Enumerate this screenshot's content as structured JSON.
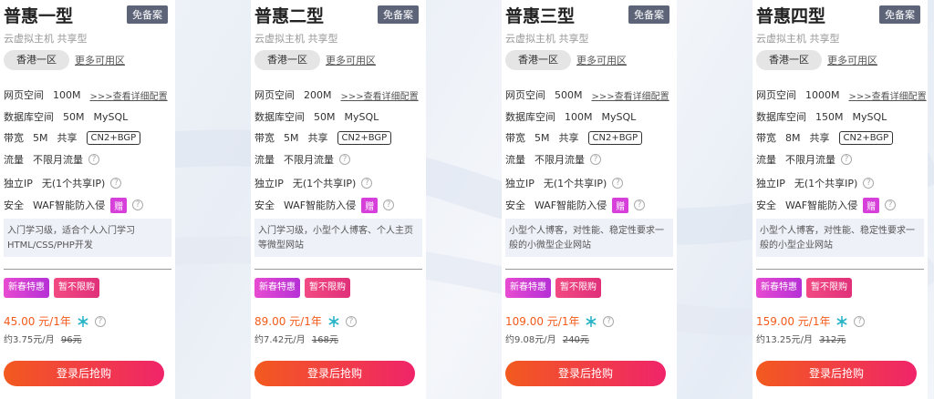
{
  "plans": [
    {
      "title": "普惠一型",
      "badge": "免备案",
      "subtitle": "云虚拟主机 共享型",
      "region": "香港一区",
      "more_regions": "更多可用区",
      "web_space_label": "网页空间",
      "web_space": "100M",
      "details_link": ">>>查看详细配置",
      "db_label": "数据库空间",
      "db_size": "50M",
      "db_type": "MySQL",
      "bw_label": "带宽",
      "bw": "5M",
      "bw_type": "共享",
      "bw_line": "CN2+BGP",
      "traffic_label": "流量",
      "traffic": "不限月流量",
      "ip_label": "独立IP",
      "ip": "无(1个共享IP)",
      "sec_label": "安全",
      "sec": "WAF智能防入侵",
      "gift": "赠",
      "desc": "入门学习级，适合个人入门学习HTML/CSS/PHP开发",
      "promo1": "新春特惠",
      "promo2": "暂不限购",
      "price": "45.00 元/1年",
      "monthly": "约3.75元/月",
      "orig": "96元",
      "buy": "登录后抢购"
    },
    {
      "title": "普惠二型",
      "badge": "免备案",
      "subtitle": "云虚拟主机 共享型",
      "region": "香港一区",
      "more_regions": "更多可用区",
      "web_space_label": "网页空间",
      "web_space": "200M",
      "details_link": ">>>查看详细配置",
      "db_label": "数据库空间",
      "db_size": "50M",
      "db_type": "MySQL",
      "bw_label": "带宽",
      "bw": "5M",
      "bw_type": "共享",
      "bw_line": "CN2+BGP",
      "traffic_label": "流量",
      "traffic": "不限月流量",
      "ip_label": "独立IP",
      "ip": "无(1个共享IP)",
      "sec_label": "安全",
      "sec": "WAF智能防入侵",
      "gift": "赠",
      "desc": "入门学习级，小型个人博客、个人主页等微型网站",
      "promo1": "新春特惠",
      "promo2": "暂不限购",
      "price": "89.00 元/1年",
      "monthly": "约7.42元/月",
      "orig": "168元",
      "buy": "登录后抢购"
    },
    {
      "title": "普惠三型",
      "badge": "免备案",
      "subtitle": "云虚拟主机 共享型",
      "region": "香港一区",
      "more_regions": "更多可用区",
      "web_space_label": "网页空间",
      "web_space": "500M",
      "details_link": ">>>查看详细配置",
      "db_label": "数据库空间",
      "db_size": "100M",
      "db_type": "MySQL",
      "bw_label": "带宽",
      "bw": "5M",
      "bw_type": "共享",
      "bw_line": "CN2+BGP",
      "traffic_label": "流量",
      "traffic": "不限月流量",
      "ip_label": "独立IP",
      "ip": "无(1个共享IP)",
      "sec_label": "安全",
      "sec": "WAF智能防入侵",
      "gift": "赠",
      "desc": "小型个人博客，对性能、稳定性要求一般的小微型企业网站",
      "promo1": "新春特惠",
      "promo2": "暂不限购",
      "price": "109.00 元/1年",
      "monthly": "约9.08元/月",
      "orig": "240元",
      "buy": "登录后抢购"
    },
    {
      "title": "普惠四型",
      "badge": "免备案",
      "subtitle": "云虚拟主机 共享型",
      "region": "香港一区",
      "more_regions": "更多可用区",
      "web_space_label": "网页空间",
      "web_space": "1000M",
      "details_link": ">>>查看详细配置",
      "db_label": "数据库空间",
      "db_size": "150M",
      "db_type": "MySQL",
      "bw_label": "带宽",
      "bw": "8M",
      "bw_type": "共享",
      "bw_line": "CN2+BGP",
      "traffic_label": "流量",
      "traffic": "不限月流量",
      "ip_label": "独立IP",
      "ip": "无(1个共享IP)",
      "sec_label": "安全",
      "sec": "WAF智能防入侵",
      "gift": "赠",
      "desc": "小型个人博客，对性能、稳定性要求一般的小型企业网站",
      "promo1": "新春特惠",
      "promo2": "暂不限购",
      "price": "159.00 元/1年",
      "monthly": "约13.25元/月",
      "orig": "312元",
      "buy": "登录后抢购"
    }
  ],
  "help_glyph": "?",
  "icons": {
    "help": "question-circle-icon",
    "snowflake": "snowflake-icon"
  },
  "colors": {
    "price": "#f25a1a",
    "button_start": "#f25a1e",
    "button_end": "#f0246a",
    "promo": "#d63fd9",
    "badge": "#5d6478"
  }
}
